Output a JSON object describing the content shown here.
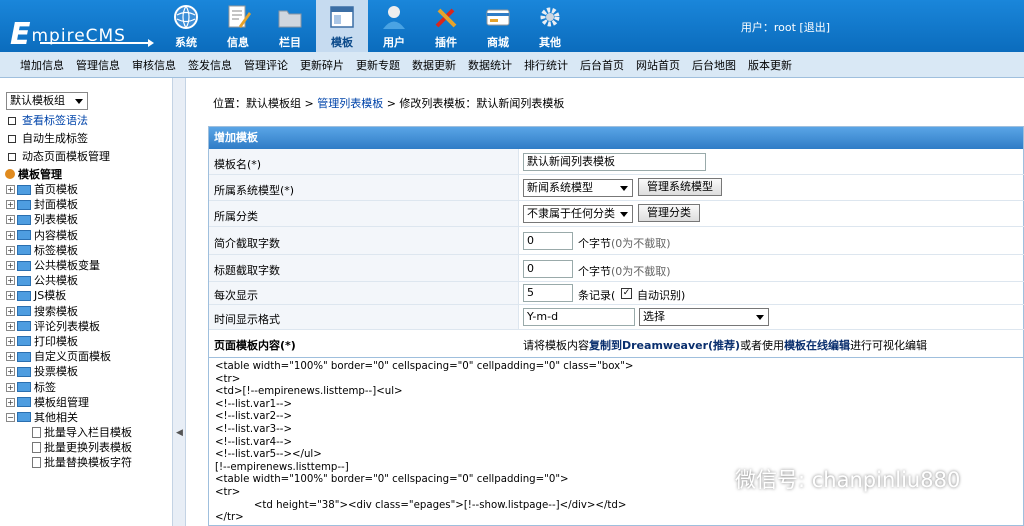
{
  "header": {
    "logo_text_big": "E",
    "logo_text_rest": "mpireCMS",
    "nav": [
      {
        "label": "系统",
        "icon": "globe-icon"
      },
      {
        "label": "信息",
        "icon": "document-edit-icon"
      },
      {
        "label": "栏目",
        "icon": "folder-icon"
      },
      {
        "label": "模板",
        "icon": "window-icon"
      },
      {
        "label": "用户",
        "icon": "user-icon"
      },
      {
        "label": "插件",
        "icon": "tools-icon"
      },
      {
        "label": "商城",
        "icon": "card-icon"
      },
      {
        "label": "其他",
        "icon": "gear-icon"
      }
    ],
    "user_label": "用户：",
    "user_name": "root",
    "logout": "[退出]"
  },
  "submenu": [
    "增加信息",
    "管理信息",
    "审核信息",
    "签发信息",
    "管理评论",
    "更新碎片",
    "更新专题",
    "数据更新",
    "数据统计",
    "排行统计",
    "后台首页",
    "网站首页",
    "后台地图",
    "版本更新"
  ],
  "sidebar": {
    "select_value": "默认模板组",
    "links": [
      {
        "label": "查看标签语法",
        "blue": true
      },
      {
        "label": "自动生成标签",
        "blue": false
      },
      {
        "label": "动态页面模板管理",
        "blue": false
      }
    ],
    "tree_title": "模板管理",
    "tree": [
      "首页模板",
      "封面模板",
      "列表模板",
      "内容模板",
      "标签模板",
      "公共模板变量",
      "公共模板",
      "JS模板",
      "搜索模板",
      "评论列表模板",
      "打印模板",
      "自定义页面模板",
      "投票模板",
      "标签",
      "模板组管理",
      "其他相关"
    ],
    "sub": [
      "批量导入栏目模板",
      "批量更换列表模板",
      "批量替换模板字符"
    ]
  },
  "crumb": {
    "prefix": "位置：默认模板组 > ",
    "link": "管理列表模板",
    "suffix": " > 修改列表模板：默认新闻列表模板"
  },
  "panel": {
    "title": "增加模板",
    "name_label": "模板名(*)",
    "name_value": "默认新闻列表模板",
    "model_label": "所属系统模型(*)",
    "model_value": "新闻系统模型",
    "model_btn": "管理系统模型",
    "cat_label": "所属分类",
    "cat_value": "不隶属于任何分类",
    "cat_btn": "管理分类",
    "intro_label": "简介截取字数",
    "intro_value": "0",
    "intro_unit": "个字节",
    "intro_note": "(0为不截取)",
    "title_label": "标题截取字数",
    "title_value": "0",
    "title_unit": "个字节",
    "title_note": "(0为不截取)",
    "per_label": "每次显示",
    "per_value": "5",
    "per_unit": "条记录(",
    "auto_label": "自动识别)",
    "time_label": "时间显示格式",
    "time_value": "Y-m-d",
    "time_select": "选择",
    "content_label": "页面模板内容(*)",
    "content_hint_1": "请将模板内容",
    "content_hint_link1": "复制到Dreamweaver(推荐)",
    "content_hint_2": "或者使用",
    "content_hint_link2": "模板在线编辑",
    "content_hint_3": "进行可视化编辑"
  },
  "code": "<table width=\"100%\" border=\"0\" cellspacing=\"0\" cellpadding=\"0\" class=\"box\">\n<tr>\n<td>[!--empirenews.listtemp--]<ul>\n<!--list.var1-->\n<!--list.var2-->\n<!--list.var3-->\n<!--list.var4-->\n<!--list.var5--></ul>\n[!--empirenews.listtemp--]\n<table width=\"100%\" border=\"0\" cellspacing=\"0\" cellpadding=\"0\">\n<tr>\n            <td height=\"38\"><div class=\"epages\">[!--show.listpage--]</div></td>\n</tr>",
  "watermark": "微信号: chanpinliu880"
}
